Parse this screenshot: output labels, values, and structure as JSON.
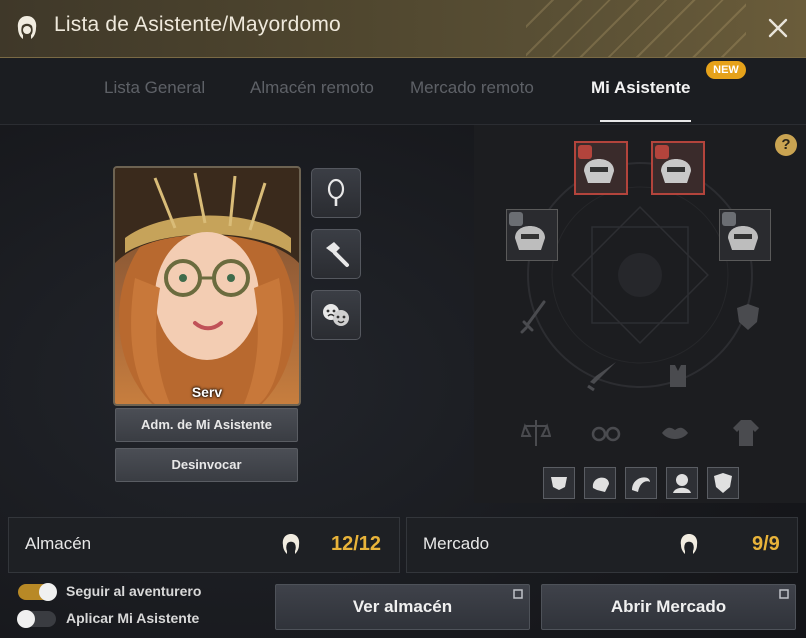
{
  "window": {
    "title": "Lista de Asistente/Mayordomo",
    "icon": "butler-head-icon",
    "close_icon": "close-icon"
  },
  "tabs": [
    {
      "label": "Lista General",
      "active": false
    },
    {
      "label": "Almacén remoto",
      "active": false
    },
    {
      "label": "Mercado remoto",
      "active": false
    },
    {
      "label": "Mi Asistente",
      "active": true,
      "badge": "NEW"
    }
  ],
  "assistant": {
    "name": "Serv",
    "side_buttons": [
      {
        "icon": "mirror-icon"
      },
      {
        "icon": "hammer-icon"
      },
      {
        "icon": "emotion-masks-icon"
      }
    ],
    "manage_label": "Adm. de Mi Asistente",
    "dismiss_label": "Desinvocar"
  },
  "equipment": {
    "help_label": "?",
    "top_slots": [
      {
        "icon": "helmet-icon",
        "status": "red"
      },
      {
        "icon": "helmet-icon",
        "status": "red"
      },
      {
        "icon": "helmet-icon",
        "status": "gray"
      },
      {
        "icon": "helmet-icon",
        "status": "gray"
      }
    ],
    "gear_icons": [
      "sword-icon",
      "shield-icon",
      "dagger-icon",
      "armor-vest-icon",
      "scales-icon",
      "glasses-icon",
      "lips-icon",
      "coat-icon"
    ],
    "mini_slots": [
      "underwear-icon",
      "hair-icon",
      "hair-style-icon",
      "face-icon",
      "emblem-icon"
    ]
  },
  "stats": {
    "storage_label": "Almacén",
    "storage_value": "12/12",
    "market_label": "Mercado",
    "market_value": "9/9"
  },
  "toggles": [
    {
      "label": "Seguir al aventurero",
      "on": true
    },
    {
      "label": "Aplicar Mi Asistente",
      "on": false
    }
  ],
  "actions": {
    "view_storage": "Ver almacén",
    "open_market": "Abrir Mercado"
  },
  "colors": {
    "accent_gold": "#e8b33a",
    "badge_orange": "#e6a21a",
    "slot_red": "#b3443c"
  }
}
